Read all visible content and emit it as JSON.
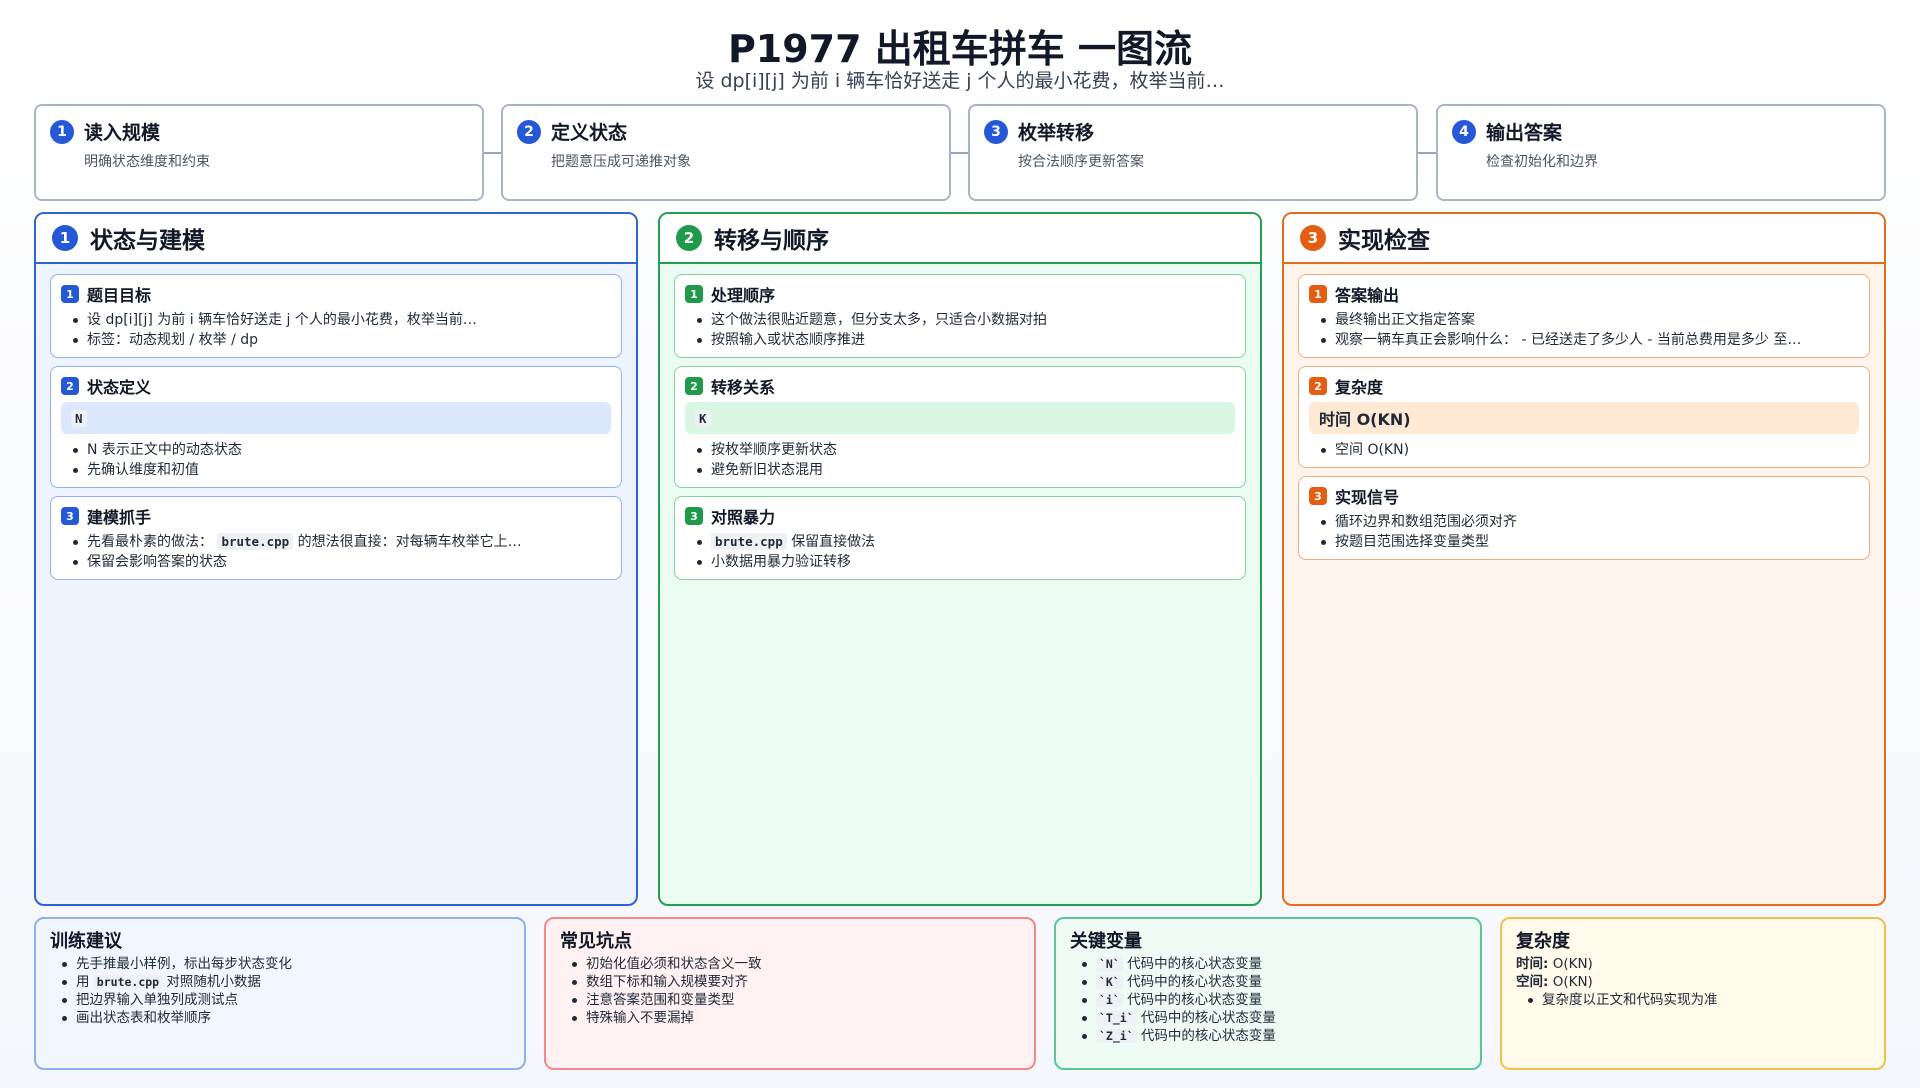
{
  "header": {
    "title": "P1977 出租车拼车 一图流",
    "subtitle": "设 dp[i][j] 为前 i 辆车恰好送走 j 个人的最小花费，枚举当前…"
  },
  "steps": [
    {
      "num": "1",
      "title": "读入规模",
      "desc": "明确状态维度和约束"
    },
    {
      "num": "2",
      "title": "定义状态",
      "desc": "把题意压成可递推对象"
    },
    {
      "num": "3",
      "title": "枚举转移",
      "desc": "按合法顺序更新答案"
    },
    {
      "num": "4",
      "title": "输出答案",
      "desc": "检查初始化和边界"
    }
  ],
  "col1": {
    "num": "1",
    "title": "状态与建模",
    "card1": {
      "num": "1",
      "title": "题目目标",
      "item1": "设 dp[i][j] 为前 i 辆车恰好送走 j 个人的最小花费，枚举当前…",
      "item2": "标签：动态规划 / 枚举 / dp"
    },
    "card2": {
      "num": "2",
      "title": "状态定义",
      "code": "N",
      "item1": "N 表示正文中的动态状态",
      "item2": "先确认维度和初值"
    },
    "card3": {
      "num": "3",
      "title": "建模抓手",
      "item1_pre": "先看最朴素的做法：",
      "item1_code": "brute.cpp",
      "item1_post": "的想法很直接：对每辆车枚举它上…",
      "item2": "保留会影响答案的状态"
    }
  },
  "col2": {
    "num": "2",
    "title": "转移与顺序",
    "card1": {
      "num": "1",
      "title": "处理顺序",
      "item1": "这个做法很贴近题意，但分支太多，只适合小数据对拍",
      "item2": "按照输入或状态顺序推进"
    },
    "card2": {
      "num": "2",
      "title": "转移关系",
      "code": "K",
      "item1": "按枚举顺序更新状态",
      "item2": "避免新旧状态混用"
    },
    "card3": {
      "num": "3",
      "title": "对照暴力",
      "item1_code": "brute.cpp",
      "item1_post": "保留直接做法",
      "item2": "小数据用暴力验证转移"
    }
  },
  "col3": {
    "num": "3",
    "title": "实现检查",
    "card1": {
      "num": "1",
      "title": "答案输出",
      "item1": "最终输出正文指定答案",
      "item2": "观察一辆车真正会影响什么： - 已经送走了多少人 - 当前总费用是多少 至…"
    },
    "card2": {
      "num": "2",
      "title": "复杂度",
      "highlight": "时间 O(KN)",
      "item1": "空间 O(KN)"
    },
    "card3": {
      "num": "3",
      "title": "实现信号",
      "item1": "循环边界和数组范围必须对齐",
      "item2": "按题目范围选择变量类型"
    }
  },
  "bottom": {
    "train": {
      "title": "训练建议",
      "item1": "先手推最小样例，标出每步状态变化",
      "item2_pre": "用",
      "item2_code": "brute.cpp",
      "item2_post": "对照随机小数据",
      "item3": "把边界输入单独列成测试点",
      "item4": "画出状态表和枚举顺序"
    },
    "pitfalls": {
      "title": "常见坑点",
      "item1": "初始化值必须和状态含义一致",
      "item2": "数组下标和输入规模要对齐",
      "item3": "注意答案范围和变量类型",
      "item4": "特殊输入不要漏掉"
    },
    "vars": {
      "title": "关键变量",
      "rows": [
        {
          "code": "`N`",
          "text": "代码中的核心状态变量"
        },
        {
          "code": "`K`",
          "text": "代码中的核心状态变量"
        },
        {
          "code": "`i`",
          "text": "代码中的核心状态变量"
        },
        {
          "code": "`T_i`",
          "text": "代码中的核心状态变量"
        },
        {
          "code": "`Z_i`",
          "text": "代码中的核心状态变量"
        }
      ]
    },
    "complexity": {
      "title": "复杂度",
      "time_label": "时间:",
      "time_value": "O(KN)",
      "space_label": "空间:",
      "space_value": "O(KN)",
      "item1": "复杂度以正文和代码实现为准"
    }
  },
  "colors": {
    "blue": "#2458d6",
    "green": "#1f9a4a",
    "orange": "#e35d12"
  }
}
